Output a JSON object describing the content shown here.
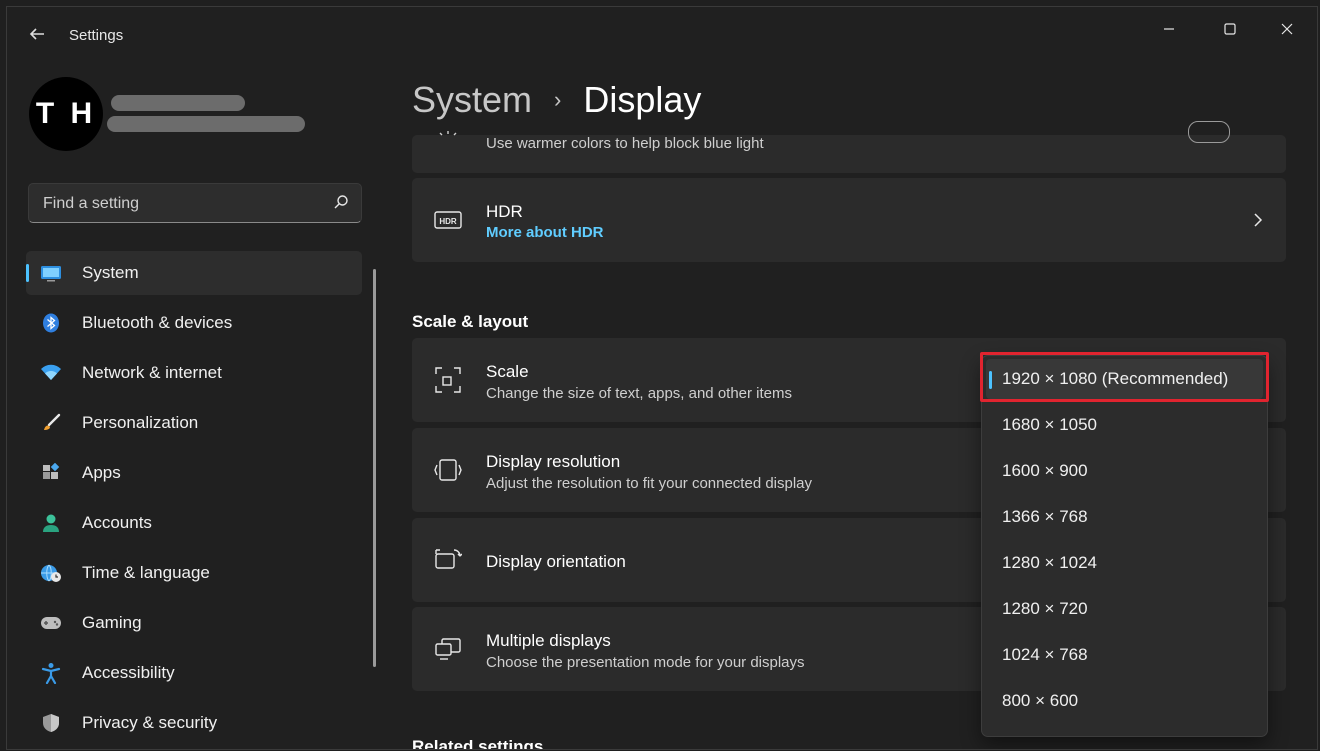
{
  "window": {
    "title": "Settings"
  },
  "profile": {
    "initials": "T H"
  },
  "search": {
    "placeholder": "Find a setting"
  },
  "sidebar": {
    "items": [
      {
        "label": "System",
        "icon": "monitor-icon",
        "active": true
      },
      {
        "label": "Bluetooth & devices",
        "icon": "bluetooth-icon"
      },
      {
        "label": "Network & internet",
        "icon": "wifi-icon"
      },
      {
        "label": "Personalization",
        "icon": "brush-icon"
      },
      {
        "label": "Apps",
        "icon": "apps-icon"
      },
      {
        "label": "Accounts",
        "icon": "person-icon"
      },
      {
        "label": "Time & language",
        "icon": "globe-clock-icon"
      },
      {
        "label": "Gaming",
        "icon": "gamepad-icon"
      },
      {
        "label": "Accessibility",
        "icon": "accessibility-icon"
      },
      {
        "label": "Privacy & security",
        "icon": "shield-icon"
      }
    ]
  },
  "header": {
    "parent": "System",
    "separator": "›",
    "current": "Display"
  },
  "cards": {
    "night_light": {
      "sub": "Use warmer colors to help block blue light"
    },
    "hdr": {
      "title": "HDR",
      "link": "More about HDR"
    },
    "scale": {
      "title": "Scale",
      "sub": "Change the size of text, apps, and other items"
    },
    "resolution": {
      "title": "Display resolution",
      "sub": "Adjust the resolution to fit your connected display"
    },
    "orientation": {
      "title": "Display orientation"
    },
    "multiple": {
      "title": "Multiple displays",
      "sub": "Choose the presentation mode for your displays"
    }
  },
  "sections": {
    "scale_layout": "Scale & layout",
    "related": "Related settings"
  },
  "dropdown": {
    "selected_index": 0,
    "options": [
      "1920 × 1080 (Recommended)",
      "1680 × 1050",
      "1600 × 900",
      "1366 × 768",
      "1280 × 1024",
      "1280 × 720",
      "1024 × 768",
      "800 × 600"
    ]
  },
  "colors": {
    "accent": "#4cc2ff",
    "link": "#60cdff",
    "highlight": "#e1242f",
    "background": "#202020",
    "card": "#2b2b2b"
  }
}
